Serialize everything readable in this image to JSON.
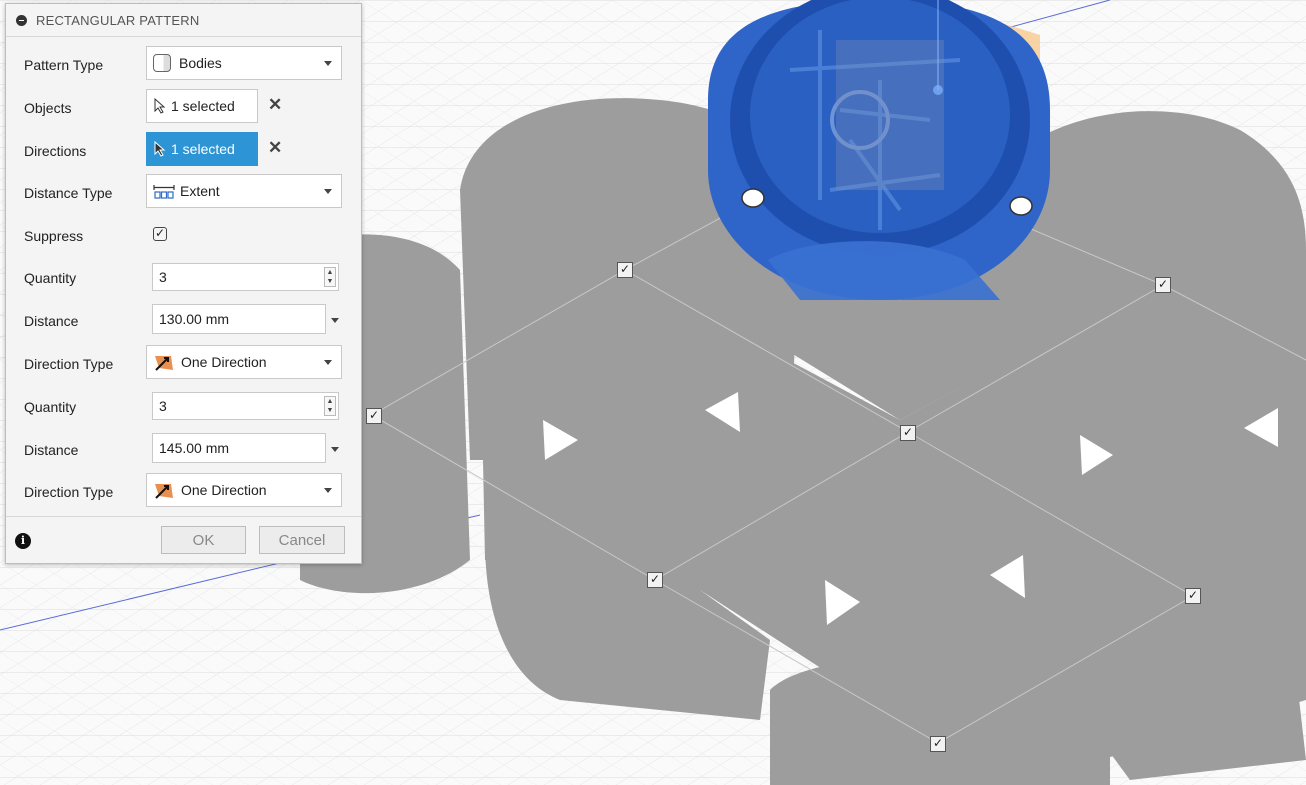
{
  "dialog": {
    "title": "RECTANGULAR PATTERN",
    "pattern_type": {
      "label": "Pattern Type",
      "value": "Bodies"
    },
    "objects": {
      "label": "Objects",
      "value": "1 selected"
    },
    "directions": {
      "label": "Directions",
      "value": "1 selected"
    },
    "distance_type": {
      "label": "Distance Type",
      "value": "Extent"
    },
    "suppress": {
      "label": "Suppress",
      "checked": true,
      "mark": "✓"
    },
    "dir1": {
      "quantity_label": "Quantity",
      "quantity": "3",
      "distance_label": "Distance",
      "distance": "130.00 mm",
      "direction_type_label": "Direction Type",
      "direction_type": "One Direction"
    },
    "dir2": {
      "quantity_label": "Quantity",
      "quantity": "3",
      "distance_label": "Distance",
      "distance": "145.00 mm",
      "direction_type_label": "Direction Type",
      "direction_type": "One Direction"
    },
    "ok_label": "OK",
    "cancel_label": "Cancel",
    "info_glyph": "i"
  },
  "viewport": {
    "check_mark": "✓",
    "instance_checks": 9,
    "colors": {
      "body": "#9c9c9c",
      "selected_body": "#2e63c4",
      "grid": "#d8d8d8",
      "accent": "#2d94d6"
    }
  }
}
